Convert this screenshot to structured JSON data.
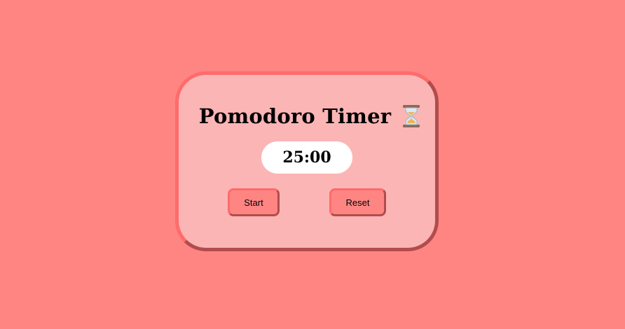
{
  "timer": {
    "title": "Pomodoro Timer",
    "time": "25:00"
  },
  "controls": {
    "start_label": "Start",
    "reset_label": "Reset"
  },
  "icons": {
    "title_icon": "hourglass-icon"
  },
  "colors": {
    "background": "#ff8583",
    "card": "#fbb5b5",
    "card_border_light": "#ff6b6b",
    "card_border_dark": "#b24c4c",
    "time_display": "#ffffff",
    "button": "#ff8583"
  }
}
